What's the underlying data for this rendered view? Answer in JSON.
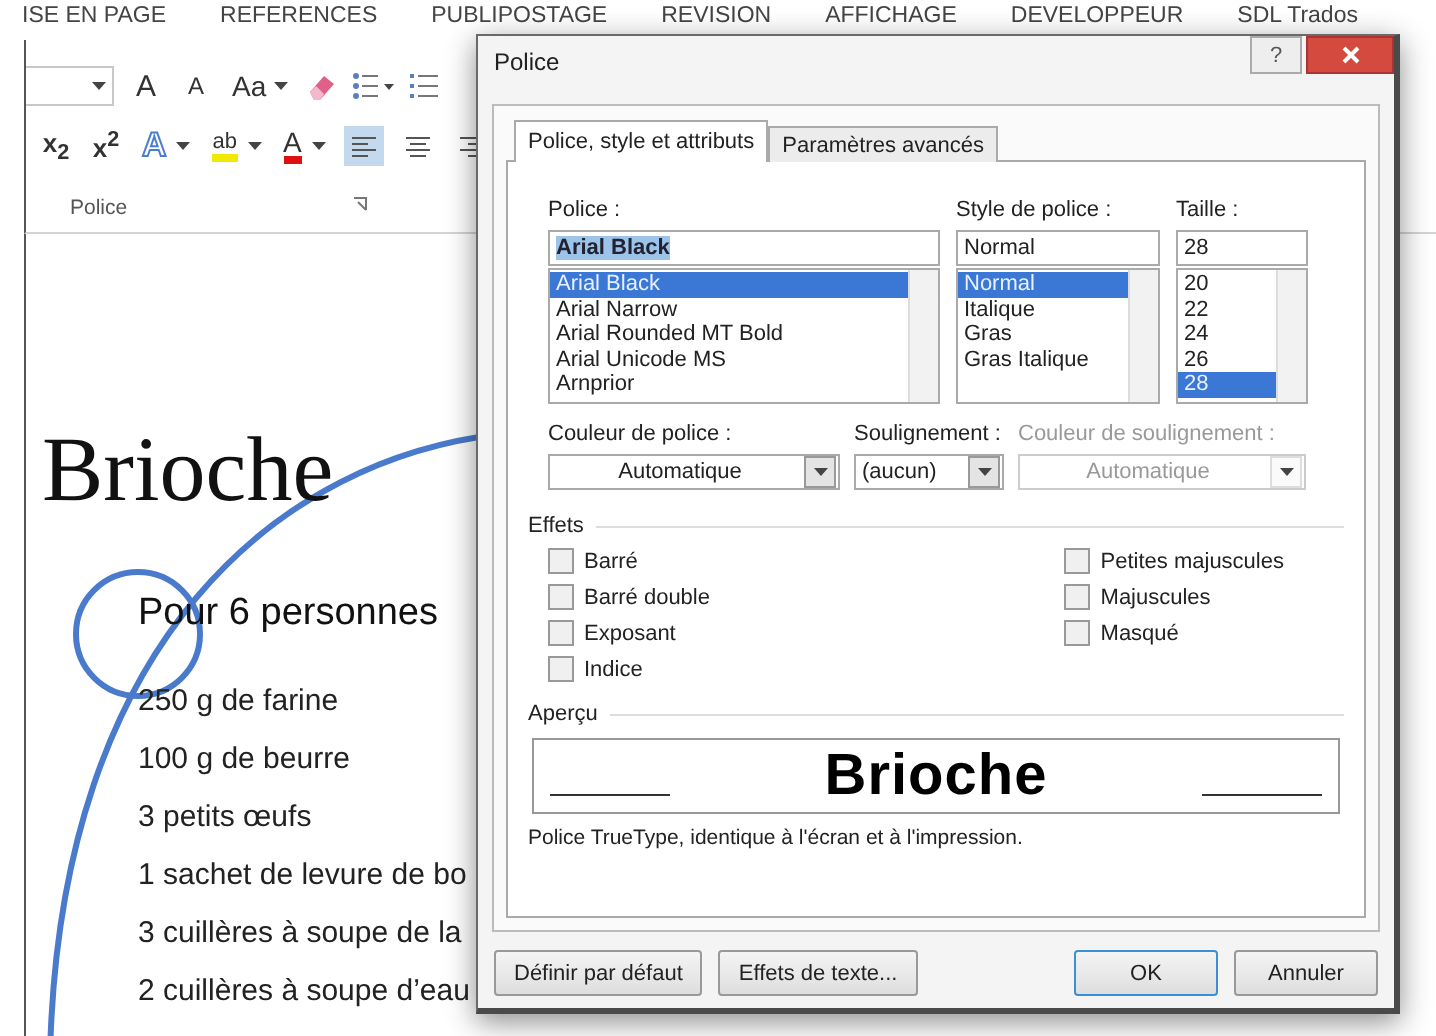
{
  "ribbon": {
    "tabs": [
      "ISE EN PAGE",
      "REFERENCES",
      "PUBLIPOSTAGE",
      "REVISION",
      "AFFICHAGE",
      "DEVELOPPEUR",
      "SDL Trados"
    ],
    "row_1": [
      {
        "kind": "combo"
      },
      {
        "kind": "grow",
        "label": "A"
      },
      {
        "kind": "shrink",
        "label": "A"
      },
      {
        "kind": "case",
        "label": "Aa"
      },
      {
        "kind": "eraser"
      },
      {
        "kind": "bullets"
      },
      {
        "kind": "numbering"
      }
    ],
    "row_2": [
      {
        "kind": "script",
        "label": "x$_{2}$"
      },
      {
        "kind": "script",
        "label": "x$^{2}$"
      },
      {
        "kind": "effect",
        "label": "A"
      },
      {
        "kind": "highlight",
        "label": "ab"
      },
      {
        "kind": "fontcolor",
        "label": "A"
      },
      {
        "kind": "align-left",
        "selected": true
      },
      {
        "kind": "align-center",
        "selected": false
      },
      {
        "kind": "align-right",
        "selected": false
      }
    ],
    "group_label": "Police"
  },
  "document": {
    "title": "Brioche",
    "subtitle": "Pour 6 personnes",
    "ingredients": [
      "250 g de farine",
      "100 g de beurre",
      "3 petits œufs",
      "1 sachet de levure de bo",
      "3 cuillères à soupe de la",
      "2 cuillères à soupe d’eau"
    ]
  },
  "dialog": {
    "title": "Police",
    "help": "?",
    "tabs": [
      {
        "label": "Police, style et attributs",
        "selected": true
      },
      {
        "label": "Paramètres avancés",
        "selected": false
      }
    ],
    "font": {
      "label": "Police :",
      "value": "Arial Black",
      "items": [
        {
          "label": "Arial Black",
          "selected": true
        },
        {
          "label": "Arial Narrow",
          "selected": false
        },
        {
          "label": "Arial Rounded MT Bold",
          "selected": false
        },
        {
          "label": "Arial Unicode MS",
          "selected": false
        },
        {
          "label": "Arnprior",
          "selected": false
        }
      ]
    },
    "style": {
      "label": "Style de police :",
      "value": "Normal",
      "items": [
        {
          "label": "Normal",
          "selected": true
        },
        {
          "label": "Italique",
          "selected": false
        },
        {
          "label": "Gras",
          "selected": false
        },
        {
          "label": "Gras Italique",
          "selected": false
        }
      ]
    },
    "size": {
      "label": "Taille :",
      "value": "28",
      "items": [
        {
          "label": "20",
          "selected": false
        },
        {
          "label": "22",
          "selected": false
        },
        {
          "label": "24",
          "selected": false
        },
        {
          "label": "26",
          "selected": false
        },
        {
          "label": "28",
          "selected": true
        }
      ]
    },
    "dropdowns": [
      {
        "label": "Couleur de police :",
        "value": "Automatique",
        "disabled": false,
        "centered": true
      },
      {
        "label": "Soulignement :",
        "value": "(aucun)",
        "disabled": false,
        "centered": false
      },
      {
        "label": "Couleur de soulignement :",
        "value": "Automatique",
        "disabled": true,
        "centered": true
      }
    ],
    "effects_label": "Effets",
    "effects_left": [
      {
        "label": "Barré",
        "checked": false
      },
      {
        "label": "Barré double",
        "checked": false
      },
      {
        "label": "Exposant",
        "checked": false
      },
      {
        "label": "Indice",
        "checked": false
      }
    ],
    "effects_right": [
      {
        "label": "Petites majuscules",
        "checked": false
      },
      {
        "label": "Majuscules",
        "checked": false
      },
      {
        "label": "Masqué",
        "checked": false
      }
    ],
    "preview_label": "Aperçu",
    "preview_text": "Brioche",
    "note": "Police TrueType, identique à l'écran et à l'impression.",
    "buttons": [
      {
        "label": "Définir par défaut",
        "default": false
      },
      {
        "label": "Effets de texte...",
        "default": false
      },
      {
        "label": "OK",
        "default": true
      },
      {
        "label": "Annuler",
        "default": false
      }
    ]
  }
}
